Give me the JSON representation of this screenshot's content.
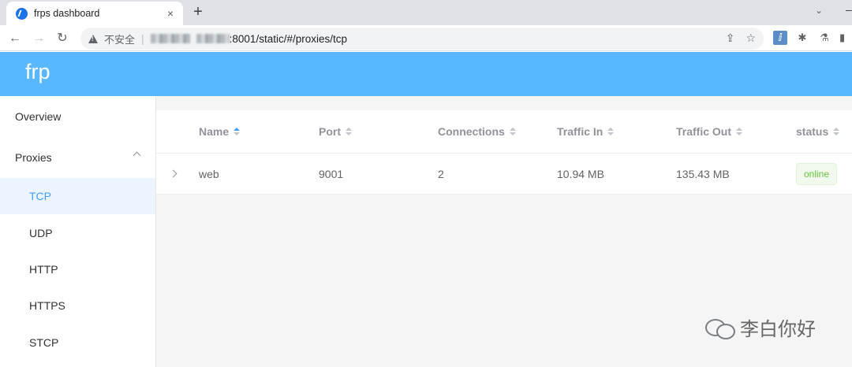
{
  "browser": {
    "tab_title": "frps dashboard",
    "tab_close": "×",
    "new_tab": "+",
    "insecure_label": "不安全",
    "url_visible": ":8001/static/#/proxies/tcp"
  },
  "app": {
    "brand": "frp",
    "accent_color": "#58b7ff",
    "sidebar": {
      "overview": "Overview",
      "proxies": "Proxies",
      "items": [
        "TCP",
        "UDP",
        "HTTP",
        "HTTPS",
        "STCP"
      ],
      "active": "TCP"
    },
    "table": {
      "columns": [
        "Name",
        "Port",
        "Connections",
        "Traffic In",
        "Traffic Out",
        "status"
      ],
      "rows": [
        {
          "name": "web",
          "port": "9001",
          "connections": "2",
          "traffic_in": "10.94 MB",
          "traffic_out": "135.43 MB",
          "status": "online"
        }
      ]
    }
  },
  "watermark": {
    "text": "李白你好",
    "icon": "wechat-icon"
  }
}
